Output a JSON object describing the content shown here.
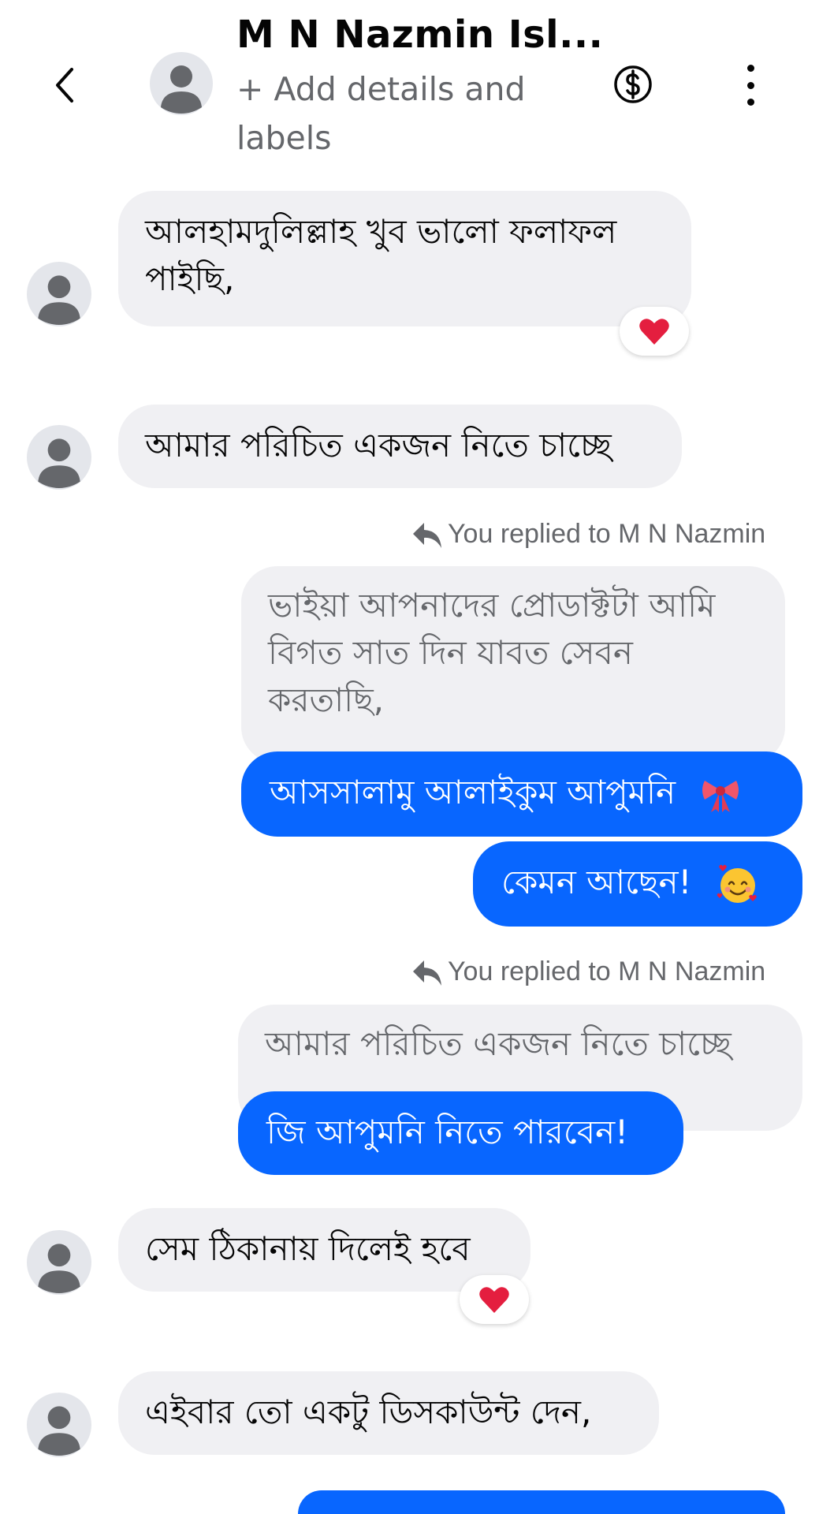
{
  "header": {
    "name": "M N Nazmin Isl...",
    "add_details": "+ Add details and labels"
  },
  "messages": [
    {
      "text": "আলহামদুলিল্লাহ খুব ভালো ফলাফল পাইছি,"
    },
    {
      "text": "আমার পরিচিত একজন নিতে চাচ্ছে"
    },
    {
      "reply_label": "You replied to M N Nazmin",
      "quote": "ভাইয়া আপনাদের প্রোডাক্টটা আমি বিগত সাত দিন যাবত সেবন করতাছি,",
      "reply1": "আসসালামু আলাইকুম আপুমনি",
      "reply2": "কেমন আছেন!"
    },
    {
      "reply_label": "You replied to M N Nazmin",
      "quote": "আমার পরিচিত একজন নিতে চাচ্ছে",
      "reply": "জি আপুমনি নিতে পারবেন!"
    },
    {
      "text": "সেম ঠিকানায় দিলেই হবে"
    },
    {
      "text": "এইবার তো একটু ডিসকাউন্ট দেন,"
    }
  ],
  "colors": {
    "accent_blue": "#0866ff",
    "incoming_bubble": "#f0f0f3",
    "secondary_text": "#65676b",
    "reaction_heart": "#e41e3f"
  },
  "icons": {
    "back": "chevron-left-icon",
    "payment": "dollar-circle-icon",
    "more": "vertical-dots-icon",
    "reaction": "heart-icon",
    "reply": "reply-arrow-icon"
  }
}
